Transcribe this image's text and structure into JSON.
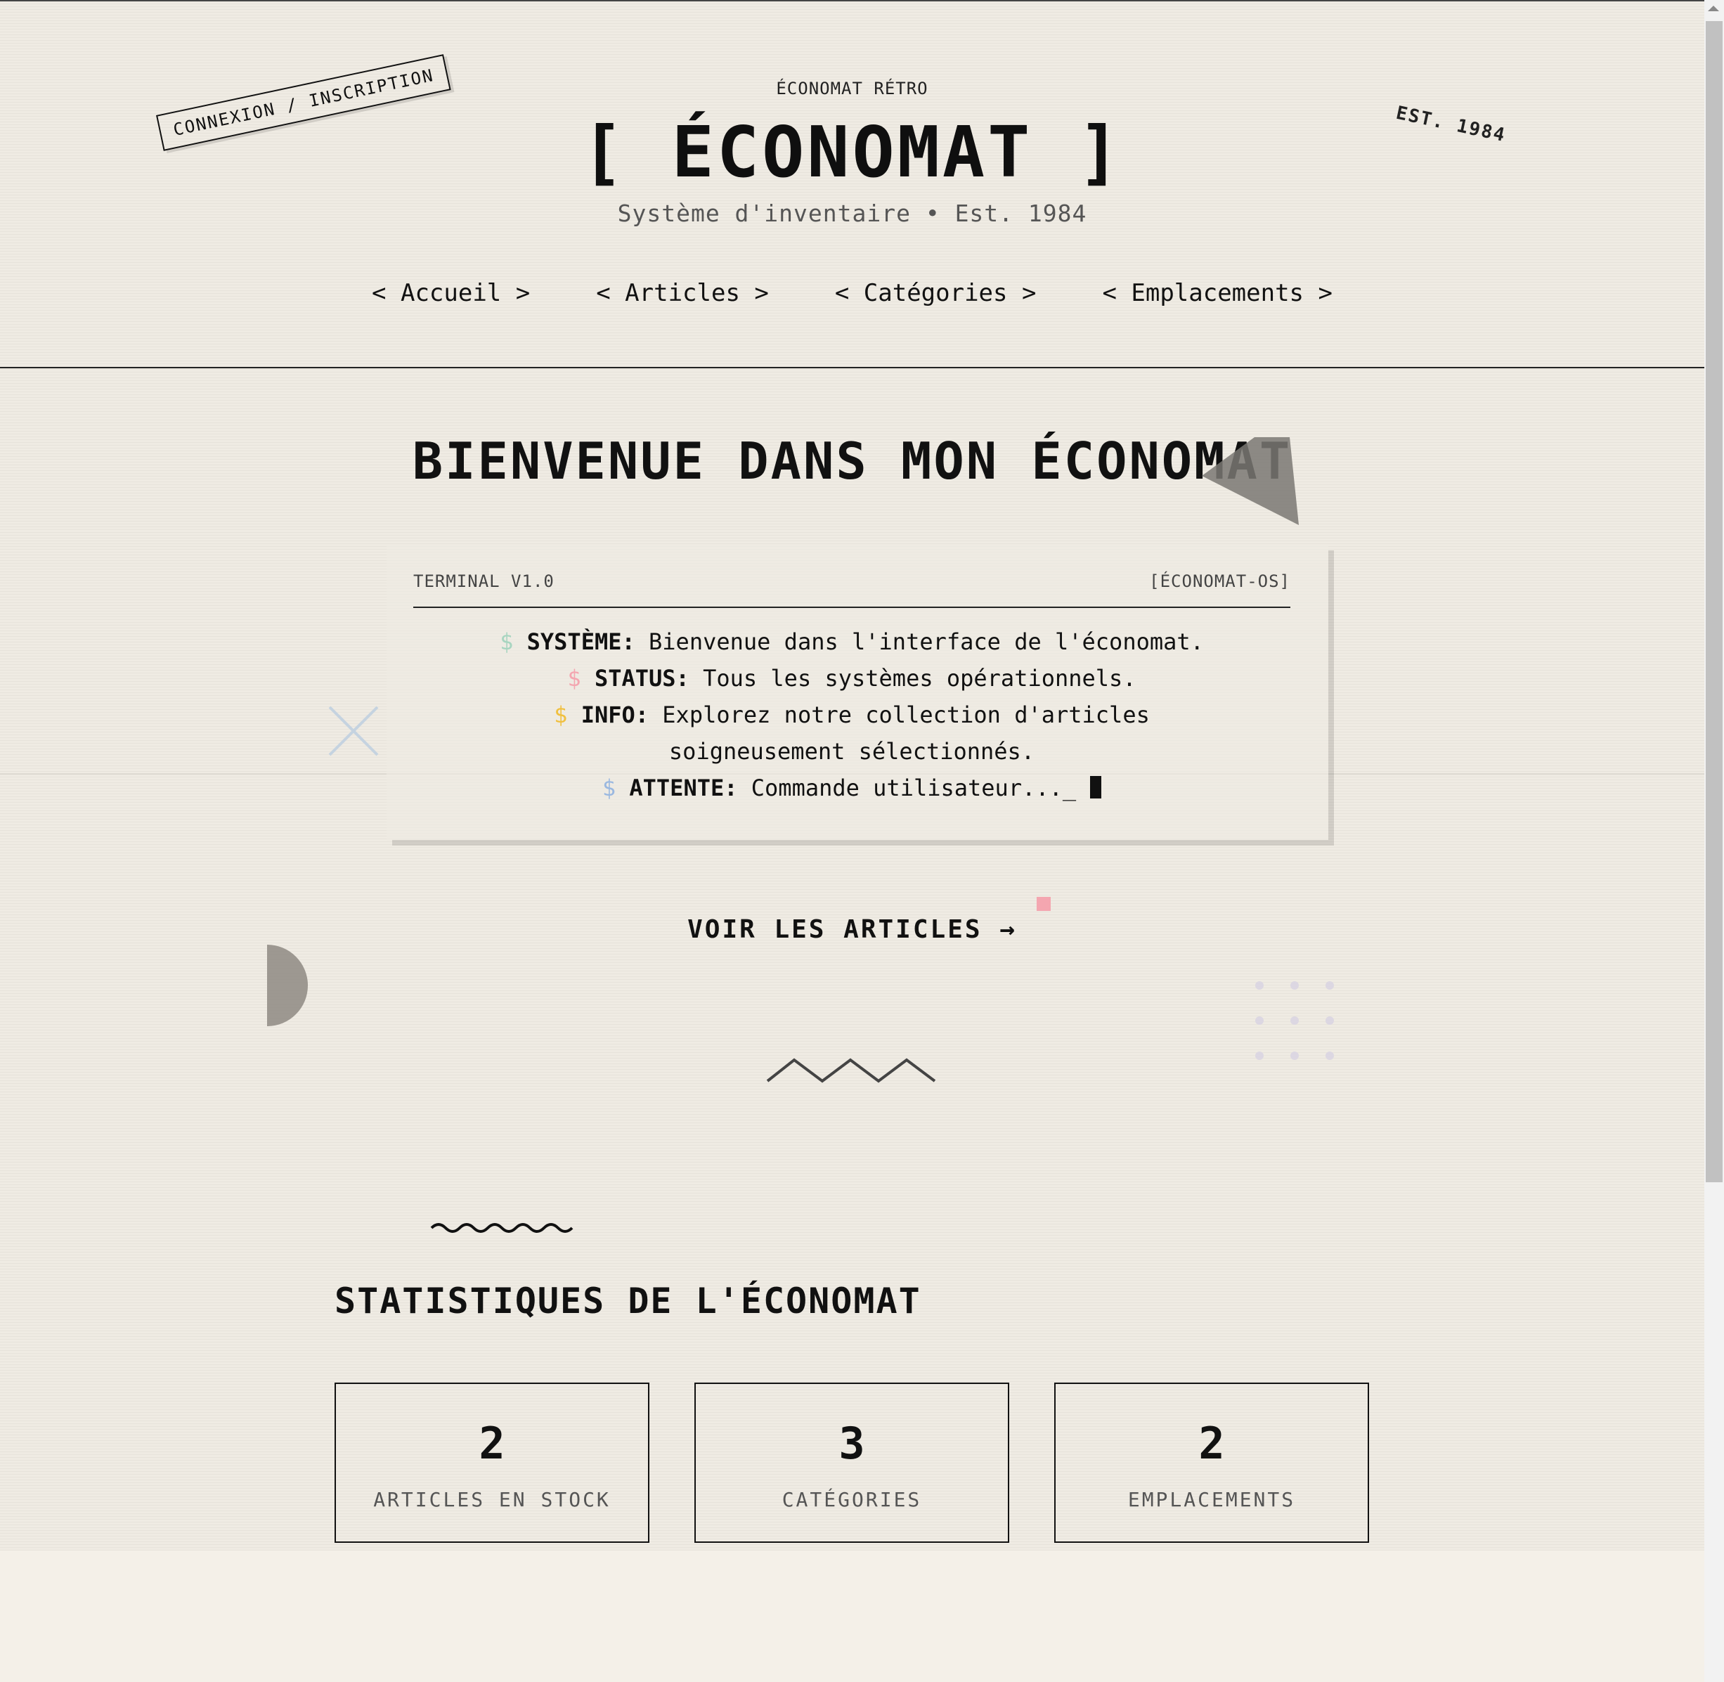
{
  "header": {
    "eyebrow": "ÉCONOMAT RÉTRO",
    "logo": "[ ÉCONOMAT ]",
    "tagline": "Système d'inventaire • Est. 1984",
    "auth_link": "CONNEXION / INSCRIPTION",
    "est_badge": "EST. 1984"
  },
  "nav": [
    {
      "label": "< Accueil >"
    },
    {
      "label": "< Articles >"
    },
    {
      "label": "< Catégories >"
    },
    {
      "label": "< Emplacements >"
    }
  ],
  "hero": {
    "title": "BIENVENUE DANS MON ÉCONOMAT",
    "cta": "VOIR LES ARTICLES →"
  },
  "terminal": {
    "label": "TERMINAL V1.0",
    "tag": "[ÉCONOMAT-OS]",
    "prompt_symbol": "$",
    "lines": [
      {
        "label": "SYSTÈME:",
        "text": "Bienvenue dans l'interface de l'économat.",
        "prompt_color": "#a8d5c0"
      },
      {
        "label": "STATUS:",
        "text": "Tous les systèmes opérationnels.",
        "prompt_color": "#f4a6b0"
      },
      {
        "label": "INFO:",
        "text": "Explorez notre collection d'articles soigneusement sélectionnés.",
        "prompt_color": "#f0c040"
      },
      {
        "label": "ATTENTE:",
        "text": "Commande utilisateur..._",
        "prompt_color": "#9ab8e0"
      }
    ]
  },
  "stats": {
    "title": "STATISTIQUES DE L'ÉCONOMAT",
    "cards": [
      {
        "value": "2",
        "label": "ARTICLES EN STOCK"
      },
      {
        "value": "3",
        "label": "CATÉGORIES"
      },
      {
        "value": "2",
        "label": "EMPLACEMENTS"
      }
    ]
  },
  "colors": {
    "background": "#efebe3",
    "text": "#111111",
    "muted": "#555555",
    "accent_pink": "#f4a6b0",
    "accent_mint": "#a8d5c0",
    "accent_yellow": "#f0c040",
    "accent_blue": "#9ab8e0"
  },
  "icons": {
    "decorations": [
      "x-mark-icon",
      "triangle-shape",
      "half-circle-shape",
      "pink-square-shape",
      "dot-grid",
      "zigzag-line",
      "wavy-line",
      "cursor-block"
    ]
  }
}
